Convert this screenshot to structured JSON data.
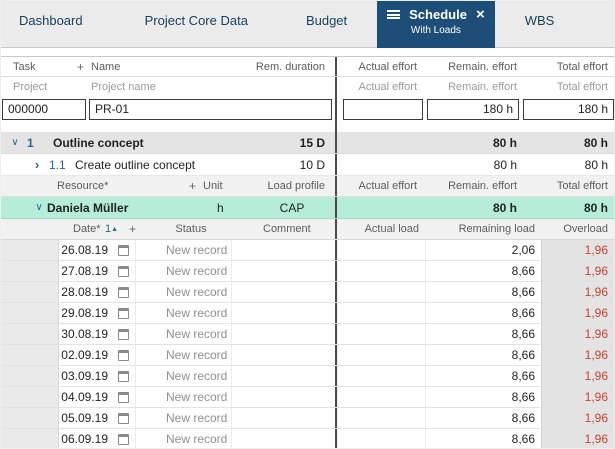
{
  "tabs": {
    "items": [
      {
        "label": "Dashboard"
      },
      {
        "label": "Project Core Data"
      },
      {
        "label": "Budget"
      },
      {
        "label": "Schedule",
        "subtitle": "With Loads",
        "active": true
      },
      {
        "label": "WBS"
      }
    ]
  },
  "task_header": {
    "task": "Task",
    "name": "Name",
    "duration": "Rem. duration",
    "actual": "Actual effort",
    "remain": "Remain. effort",
    "total": "Total effort"
  },
  "project_header": {
    "project": "Project",
    "name": "Project name",
    "actual": "Actual effort",
    "remain": "Remain. effort",
    "total": "Total effort"
  },
  "project": {
    "id": "000000",
    "name": "PR-01",
    "actual": "",
    "remain": "180 h",
    "total": "180 h"
  },
  "tasks": [
    {
      "number": "1",
      "name": "Outline concept",
      "duration": "15 D",
      "actual": "",
      "remain": "80 h",
      "total": "80 h"
    },
    {
      "number": "1.1",
      "name": "Create outline concept",
      "duration": "10 D",
      "actual": "",
      "remain": "80 h",
      "total": "80 h"
    }
  ],
  "resource_header": {
    "resource": "Resource*",
    "unit": "Unit",
    "load_profile": "Load profile",
    "actual": "Actual effort",
    "remain": "Remain. effort",
    "total": "Total effort"
  },
  "resource": {
    "name": "Daniela Müller",
    "unit": "h",
    "load_profile": "CAP",
    "actual": "",
    "remain": "80 h",
    "total": "80 h"
  },
  "load_header": {
    "date": "Date*",
    "sort": "1",
    "status": "Status",
    "comment": "Comment",
    "actual": "Actual load",
    "remaining": "Remaining load",
    "overload": "Overload"
  },
  "loads": [
    {
      "date": "26.08.19",
      "status": "New record",
      "actual": "",
      "remaining": "2,06",
      "overload": "1,96"
    },
    {
      "date": "27.08.19",
      "status": "New record",
      "actual": "",
      "remaining": "8,66",
      "overload": "1,96"
    },
    {
      "date": "28.08.19",
      "status": "New record",
      "actual": "",
      "remaining": "8,66",
      "overload": "1,96"
    },
    {
      "date": "29.08.19",
      "status": "New record",
      "actual": "",
      "remaining": "8,66",
      "overload": "1,96"
    },
    {
      "date": "30.08.19",
      "status": "New record",
      "actual": "",
      "remaining": "8,66",
      "overload": "1,96"
    },
    {
      "date": "02.09.19",
      "status": "New record",
      "actual": "",
      "remaining": "8,66",
      "overload": "1,96"
    },
    {
      "date": "03.09.19",
      "status": "New record",
      "actual": "",
      "remaining": "8,66",
      "overload": "1,96"
    },
    {
      "date": "04.09.19",
      "status": "New record",
      "actual": "",
      "remaining": "8,66",
      "overload": "1,96"
    },
    {
      "date": "05.09.19",
      "status": "New record",
      "actual": "",
      "remaining": "8,66",
      "overload": "1,96"
    },
    {
      "date": "06.09.19",
      "status": "New record",
      "actual": "",
      "remaining": "8,66",
      "overload": "1,96"
    }
  ],
  "colors": {
    "active_tab": "#1c4e78",
    "resource_highlight": "#b5edd8",
    "overload_text": "#c9412f",
    "link_blue": "#1d6a96"
  }
}
